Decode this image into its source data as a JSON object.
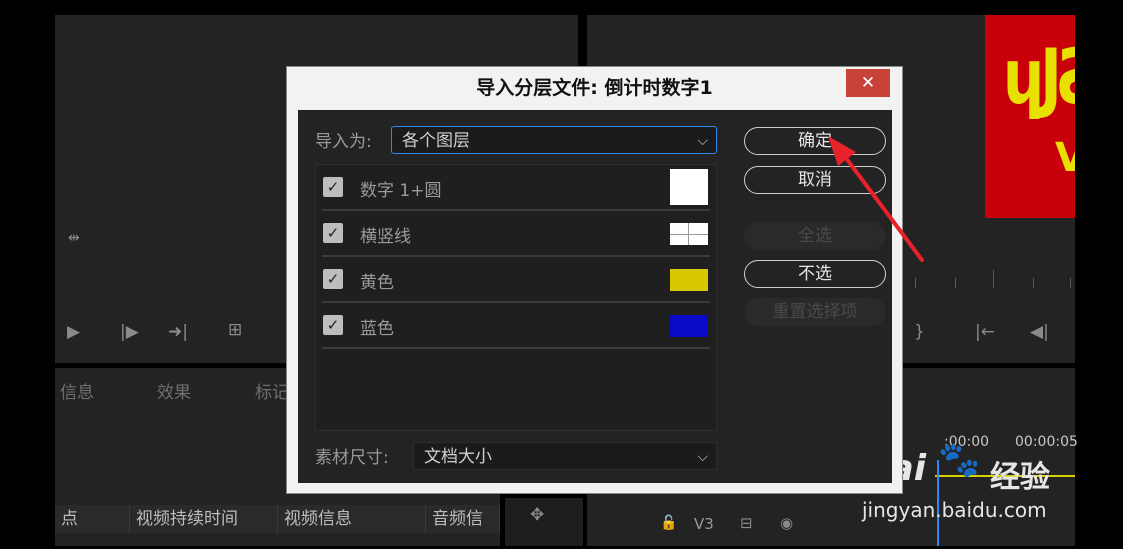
{
  "dialog": {
    "title": "导入分层文件: 倒计时数字1",
    "close_glyph": "✕",
    "import_as_label": "导入为:",
    "import_as_value": "各个图层",
    "layers": [
      {
        "name": "数字 1+圆",
        "checked": true,
        "swatch": "#ffffff"
      },
      {
        "name": "横竖线",
        "checked": true,
        "swatch": "#ffffff"
      },
      {
        "name": "黄色",
        "checked": true,
        "swatch": "#d8c800"
      },
      {
        "name": "蓝色",
        "checked": true,
        "swatch": "#0a0ac8"
      }
    ],
    "footage_size_label": "素材尺寸:",
    "footage_size_value": "文档大小",
    "buttons": {
      "ok": "确定",
      "cancel": "取消",
      "select_all": "全选",
      "select_none": "不选",
      "reset": "重置选择项"
    }
  },
  "background": {
    "tabs": [
      "信息",
      "效果",
      "标记"
    ],
    "columns": [
      "点",
      "视频持续时间",
      "视频信息",
      "音频信"
    ],
    "track_label": "V3",
    "timecodes": [
      ":00:00",
      "00:00:05"
    ]
  },
  "watermark": {
    "brand": "Bai",
    "brand_cn": "经验",
    "url": "jingyan.baidu.com"
  },
  "colors": {
    "close_red": "#c9423a",
    "focus_blue": "#2d8ceb",
    "annotation_arrow": "#e8222a"
  },
  "icons": {
    "checkbox": "✓",
    "chevron": "⌵"
  }
}
